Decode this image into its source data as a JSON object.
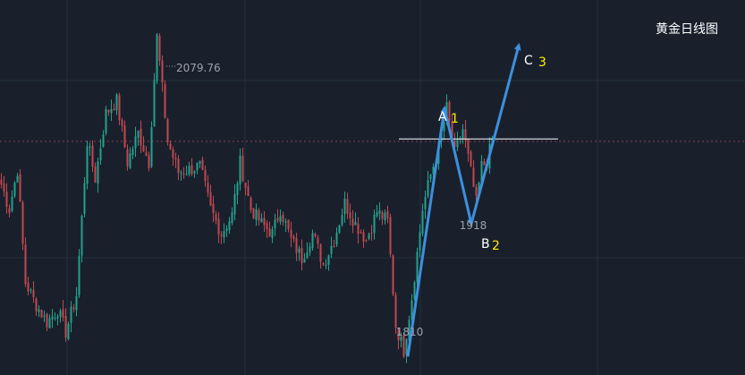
{
  "chart_data": {
    "type": "candlestick",
    "title": "黄金日线图",
    "colors": {
      "background": "#19202c",
      "grid": "#24303c",
      "up": "#24a18c",
      "down": "#c1484f",
      "arrow": "#3d8fde",
      "resistance_line": "#ffffff",
      "dotted_line": "#8b3d52",
      "letter": "#ffffff",
      "number": "#ffee00",
      "price_label": "#9aa3ad"
    },
    "y_range": [
      1795,
      2100
    ],
    "price_annotations": {
      "high": "2079.76",
      "low": "1810",
      "pullback": "1918"
    },
    "wave_labels": [
      {
        "letter": "A",
        "number": "1",
        "price": 2012
      },
      {
        "letter": "B",
        "number": "2",
        "price": 1900
      },
      {
        "letter": "C",
        "number": "3",
        "price": 2063
      }
    ],
    "resistance_level": 1987,
    "dotted_level": 1985,
    "waypoints": [
      [
        0,
        1950
      ],
      [
        3,
        1930
      ],
      [
        6,
        1962
      ],
      [
        9,
        1870
      ],
      [
        13,
        1852
      ],
      [
        17,
        1838
      ],
      [
        21,
        1848
      ],
      [
        24,
        1830
      ],
      [
        28,
        1860
      ],
      [
        32,
        1985
      ],
      [
        35,
        1955
      ],
      [
        39,
        2008
      ],
      [
        43,
        2018
      ],
      [
        47,
        1968
      ],
      [
        51,
        1992
      ],
      [
        55,
        1968
      ],
      [
        58,
        2070
      ],
      [
        62,
        1985
      ],
      [
        66,
        1960
      ],
      [
        70,
        1962
      ],
      [
        74,
        1965
      ],
      [
        78,
        1930
      ],
      [
        82,
        1910
      ],
      [
        86,
        1925
      ],
      [
        89,
        1968
      ],
      [
        93,
        1930
      ],
      [
        97,
        1918
      ],
      [
        101,
        1910
      ],
      [
        104,
        1930
      ],
      [
        108,
        1905
      ],
      [
        112,
        1890
      ],
      [
        116,
        1910
      ],
      [
        120,
        1885
      ],
      [
        124,
        1905
      ],
      [
        128,
        1935
      ],
      [
        132,
        1918
      ],
      [
        136,
        1905
      ],
      [
        140,
        1928
      ],
      [
        144,
        1920
      ],
      [
        147,
        1835
      ],
      [
        150,
        1815
      ],
      [
        153,
        1858
      ],
      [
        157,
        1930
      ],
      [
        160,
        1958
      ],
      [
        163,
        1980
      ],
      [
        166,
        2012
      ],
      [
        169,
        1975
      ],
      [
        172,
        1995
      ],
      [
        175,
        1960
      ],
      [
        177,
        1935
      ],
      [
        179,
        1965
      ],
      [
        181,
        1968
      ],
      [
        183,
        1987
      ]
    ],
    "arrows": [
      {
        "from": [
          456,
          1810
        ],
        "to": [
          497,
          2012
        ]
      },
      {
        "from": [
          497,
          2012
        ],
        "to": [
          527,
          1918
        ]
      },
      {
        "from": [
          527,
          1918
        ],
        "to": [
          580,
          2063
        ]
      }
    ]
  }
}
